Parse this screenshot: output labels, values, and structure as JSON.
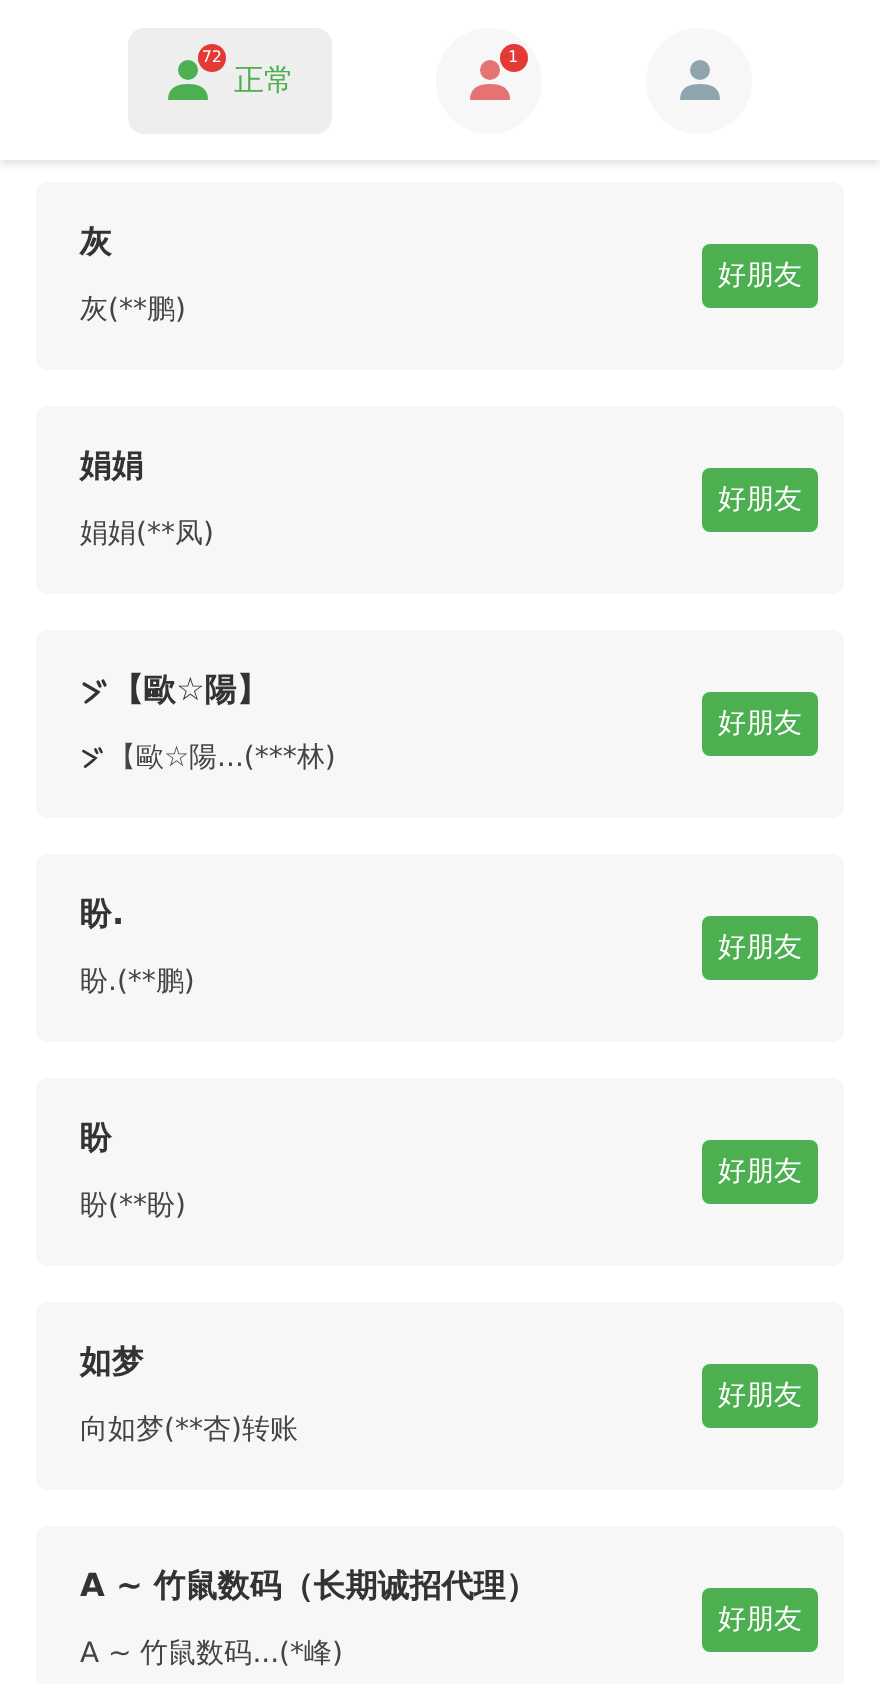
{
  "tabs": [
    {
      "kind": "normal",
      "label": "正常",
      "badge": "72",
      "selected": true
    },
    {
      "kind": "blocked",
      "badge": "1",
      "selected": false
    },
    {
      "kind": "plain",
      "selected": false
    }
  ],
  "friends": [
    {
      "name": "灰",
      "detail": "灰(**鹏)",
      "action": "好朋友"
    },
    {
      "name": "娟娟",
      "detail": "娟娟(**凤)",
      "action": "好朋友"
    },
    {
      "name": "【歐☆陽】",
      "detail": "【歐☆陽...(***林)",
      "lead_mark": true,
      "action": "好朋友"
    },
    {
      "name": "盼.",
      "detail": "盼.(**鹏)",
      "action": "好朋友"
    },
    {
      "name": "盼",
      "detail": "盼(**盼)",
      "action": "好朋友"
    },
    {
      "name": "如梦",
      "detail": "向如梦(**杏)转账",
      "action": "好朋友"
    },
    {
      "name": "A ~ 竹鼠数码（长期诚招代理）",
      "detail": "A ~ 竹鼠数码...(*峰)",
      "action": "好朋友"
    }
  ]
}
